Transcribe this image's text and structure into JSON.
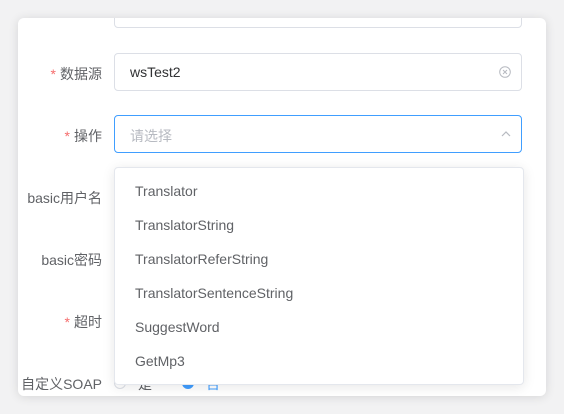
{
  "form": {
    "datasource_label": "数据源",
    "datasource_value": "wsTest2",
    "operation_label": "操作",
    "operation_placeholder": "请选择",
    "basic_user_label": "basic用户名",
    "basic_password_label": "basic密码",
    "timeout_label": "超时",
    "custom_soap_label": "自定义SOAP",
    "custom_soap_yes": "是",
    "custom_soap_no": "否",
    "required_mark": "*"
  },
  "dropdown": {
    "options": [
      "Translator",
      "TranslatorString",
      "TranslatorReferString",
      "TranslatorSentenceString",
      "SuggestWord",
      "GetMp3"
    ]
  },
  "colors": {
    "accent": "#409eff",
    "required": "#f56c6c",
    "border": "#dcdfe6"
  }
}
